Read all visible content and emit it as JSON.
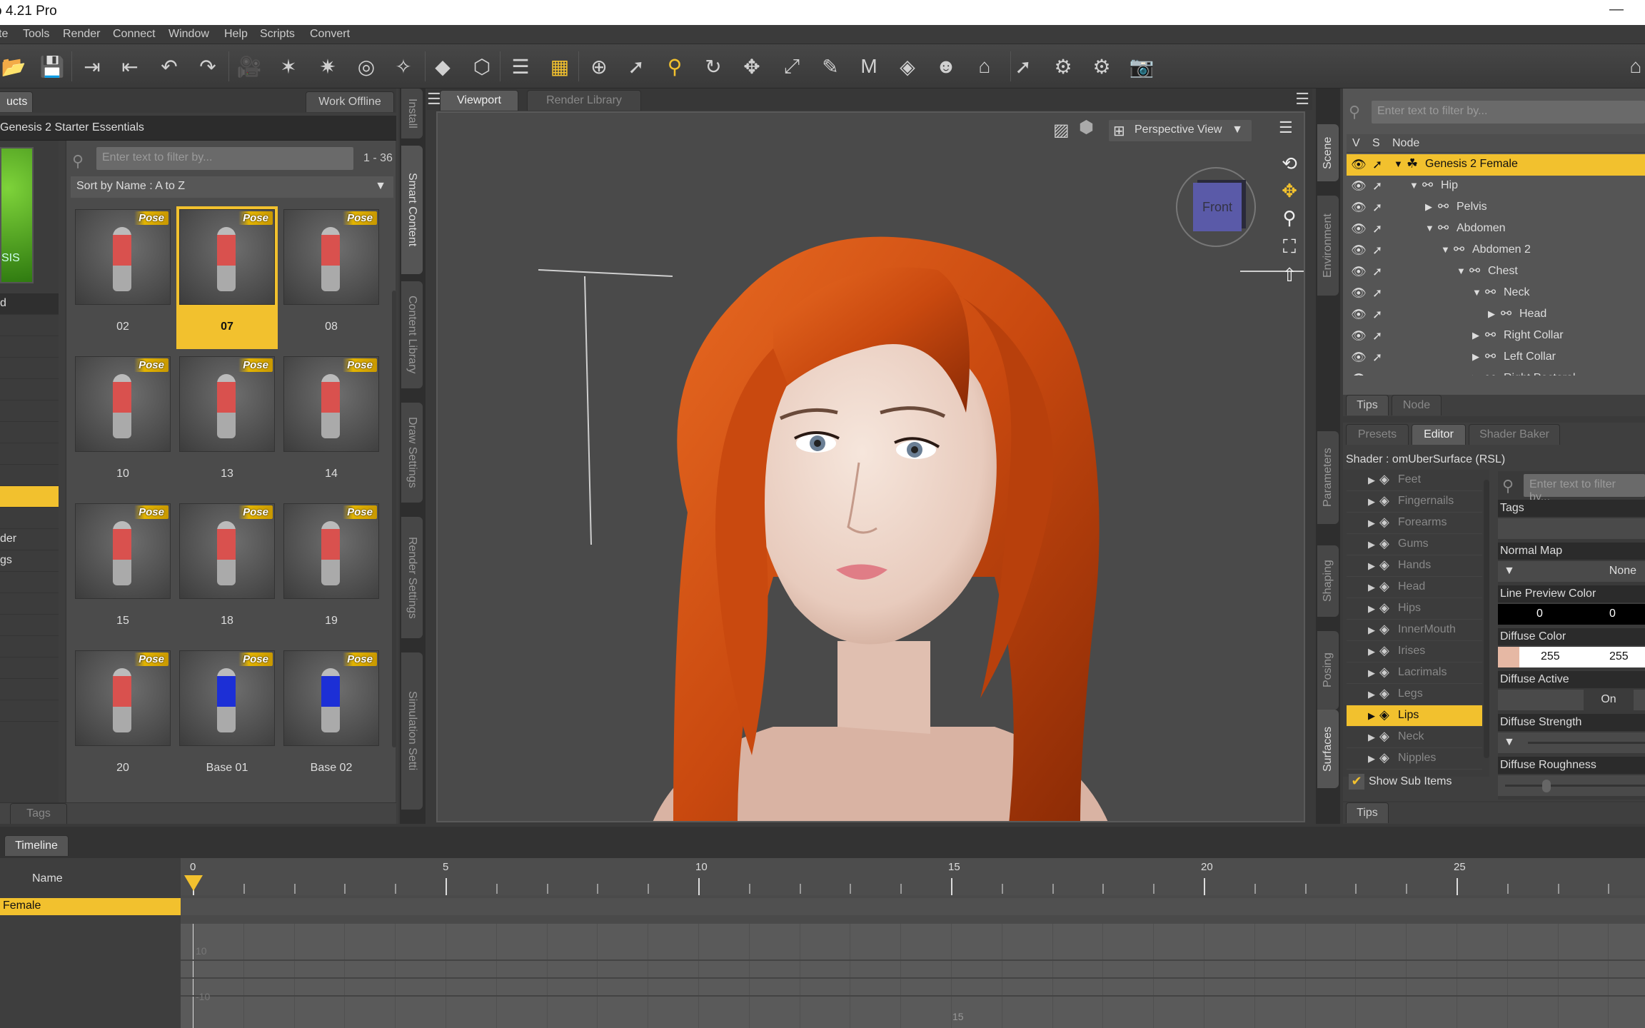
{
  "window": {
    "title": "o 4.21 Pro",
    "minimize": "—"
  },
  "menu": [
    "te",
    "Tools",
    "Render",
    "Connect",
    "Window",
    "Help",
    "Scripts",
    "Convert"
  ],
  "toolbar": {
    "icons": [
      "open-icon",
      "save-icon",
      "import-icon",
      "export-icon",
      "undo-icon",
      "redo-icon",
      "new-camera-icon",
      "new-distant-light-icon",
      "new-point-light-icon",
      "new-spot-light-icon",
      "new-linear-light-icon",
      "new-node-icon",
      "new-group-icon",
      "align-icon",
      "grid-icon",
      "universal-tool-icon",
      "select-tool-icon",
      "node-weight-tool-icon",
      "rotate-tool-icon",
      "translate-tool-icon",
      "scale-tool-icon",
      "joint-editor-icon",
      "geometry-editor-icon",
      "surface-selection-icon",
      "active-pose-icon",
      "render-settings-icon",
      "region-navigator-icon",
      "spot-render-icon",
      "render-icon",
      "render-camera-icon",
      "ds-home-icon"
    ],
    "glyphs": [
      "📂",
      "💾",
      "⇥",
      "⇤",
      "↶",
      "↷",
      "🎥",
      "✶",
      "✷",
      "◎",
      "✧",
      "◆",
      "⬡",
      "☰",
      "▦",
      "⊕",
      "➚",
      "⚲",
      "↻",
      "✥",
      "⤢",
      "✎",
      "M",
      "◈",
      "☻",
      "⌂",
      "➚",
      "⚙",
      "⚙",
      "📷",
      "⌂"
    ]
  },
  "content_library": {
    "tab": "ucts",
    "work_offline": "Work Offline",
    "product": "Genesis 2 Starter Essentials",
    "product_thumb_text": "SIS",
    "filter_placeholder": "Enter text to filter by...",
    "count": "1 - 36",
    "sort": "Sort by Name : A to Z",
    "categories": [
      "d",
      "",
      "",
      "",
      "",
      "",
      "",
      "",
      "",
      "",
      "",
      "der",
      "gs",
      "",
      "",
      "",
      "",
      "",
      "",
      ""
    ],
    "selected_category": 9,
    "items": [
      {
        "label": "02",
        "badge": "Pose",
        "selected": false,
        "color": "#d9514e"
      },
      {
        "label": "07",
        "badge": "Pose",
        "selected": true,
        "color": "#d9514e"
      },
      {
        "label": "08",
        "badge": "Pose",
        "selected": false,
        "color": "#d9514e"
      },
      {
        "label": "10",
        "badge": "Pose",
        "selected": false,
        "color": "#d9514e"
      },
      {
        "label": "13",
        "badge": "Pose",
        "selected": false,
        "color": "#d9514e"
      },
      {
        "label": "14",
        "badge": "Pose",
        "selected": false,
        "color": "#d9514e"
      },
      {
        "label": "15",
        "badge": "Pose",
        "selected": false,
        "color": "#d9514e"
      },
      {
        "label": "18",
        "badge": "Pose",
        "selected": false,
        "color": "#d9514e"
      },
      {
        "label": "19",
        "badge": "Pose",
        "selected": false,
        "color": "#d9514e"
      },
      {
        "label": "20",
        "badge": "Pose",
        "selected": false,
        "color": "#d9514e"
      },
      {
        "label": "Base 01",
        "badge": "Pose",
        "selected": false,
        "color": "#1c2fd6"
      },
      {
        "label": "Base 02",
        "badge": "Pose",
        "selected": false,
        "color": "#1c2fd6"
      }
    ],
    "bottom_tab": "Tags"
  },
  "left_side_tabs": [
    "Install",
    "Smart Content",
    "Content Library",
    "Draw Settings",
    "Render Settings",
    "Simulation Setti"
  ],
  "viewport": {
    "tabs": [
      "Viewport",
      "Render Library"
    ],
    "view": "Perspective View",
    "cube_label": "Front"
  },
  "scene": {
    "filter_placeholder": "Enter text to filter by...",
    "columns": [
      "V",
      "S",
      "Node"
    ],
    "nodes": [
      {
        "label": "Genesis 2 Female",
        "depth": 0,
        "expanded": true,
        "selected": true,
        "type": "figure"
      },
      {
        "label": "Hip",
        "depth": 1,
        "expanded": true
      },
      {
        "label": "Pelvis",
        "depth": 2,
        "expanded": false
      },
      {
        "label": "Abdomen",
        "depth": 2,
        "expanded": true
      },
      {
        "label": "Abdomen 2",
        "depth": 3,
        "expanded": true
      },
      {
        "label": "Chest",
        "depth": 4,
        "expanded": true
      },
      {
        "label": "Neck",
        "depth": 5,
        "expanded": true
      },
      {
        "label": "Head",
        "depth": 6,
        "expanded": false
      },
      {
        "label": "Right Collar",
        "depth": 5,
        "expanded": false
      },
      {
        "label": "Left Collar",
        "depth": 5,
        "expanded": false
      },
      {
        "label": "Right Pectoral",
        "depth": 5,
        "expanded": false
      }
    ],
    "bottom_tabs": [
      "Tips",
      "Node"
    ]
  },
  "right_side_tabs": [
    "Scene",
    "Environment",
    "Parameters",
    "Shaping",
    "Posing",
    "Surfaces"
  ],
  "surfaces": {
    "tabs": [
      "Presets",
      "Editor",
      "Shader Baker"
    ],
    "active_tab": "Editor",
    "shader": "Shader : omUberSurface (RSL)",
    "items": [
      "Feet",
      "Fingernails",
      "Forearms",
      "Gums",
      "Hands",
      "Head",
      "Hips",
      "InnerMouth",
      "Irises",
      "Lacrimals",
      "Legs",
      "Lips",
      "Neck",
      "Nipples"
    ],
    "selected": "Lips",
    "show_sub_items": "Show Sub Items",
    "filter_placeholder": "Enter text to filter by...",
    "props": {
      "tags": "Tags",
      "normal_map": {
        "label": "Normal Map",
        "value": "None"
      },
      "line_preview": {
        "label": "Line Preview Color",
        "values": [
          "0",
          "0"
        ]
      },
      "diffuse_color": {
        "label": "Diffuse Color",
        "values": [
          "255",
          "255"
        ]
      },
      "diffuse_active": {
        "label": "Diffuse Active",
        "value": "On"
      },
      "diffuse_strength": {
        "label": "Diffuse Strength"
      },
      "diffuse_roughness": {
        "label": "Diffuse Roughness"
      }
    },
    "bottom_tab": "Tips"
  },
  "timeline": {
    "tab": "Timeline",
    "name_header": "Name",
    "row": "Female",
    "frame_labels": [
      "0",
      "5",
      "10",
      "15",
      "20",
      "25"
    ],
    "current_frame": 0,
    "graph_labels": [
      "10",
      "-10",
      "15"
    ]
  },
  "colors": {
    "accent": "#f2c12e",
    "panel": "#4b4b4b",
    "hair": "#d9581a"
  }
}
